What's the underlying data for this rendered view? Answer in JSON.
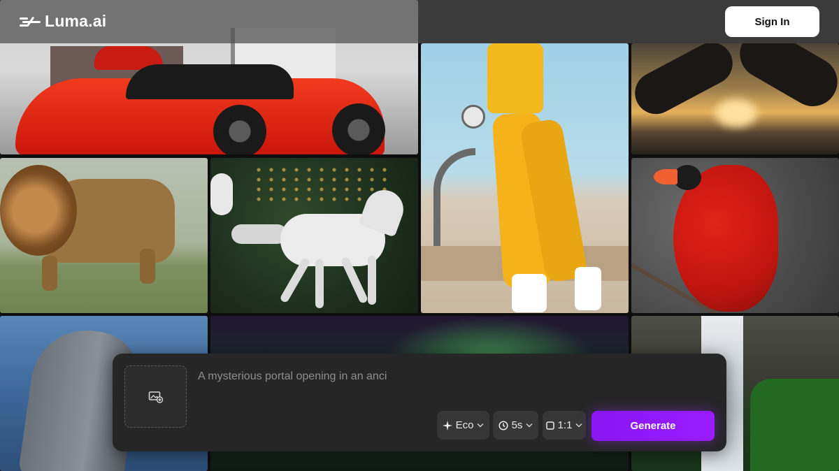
{
  "header": {
    "brand": "Luma.ai",
    "signin_label": "Sign In"
  },
  "gallery": {
    "tiles": [
      "red sports car",
      "woman in yellow tracksuit",
      "hands making heart at sunset",
      "lion",
      "white horse",
      "red cardinal",
      "dolphin",
      "aurora",
      "waterfall"
    ]
  },
  "composer": {
    "prompt_placeholder": "A mysterious portal opening in an anci",
    "upload_icon": "image-add-icon",
    "mode_label": "Eco",
    "mode_icon": "sparkle-icon",
    "duration_label": "5s",
    "duration_icon": "clock-icon",
    "ratio_label": "1:1",
    "ratio_icon": "square-icon",
    "chevron_icon": "chevron-down-icon",
    "generate_label": "Generate"
  },
  "colors": {
    "accent": "#9a1cff",
    "panel": "#262626",
    "pill": "#363636"
  }
}
